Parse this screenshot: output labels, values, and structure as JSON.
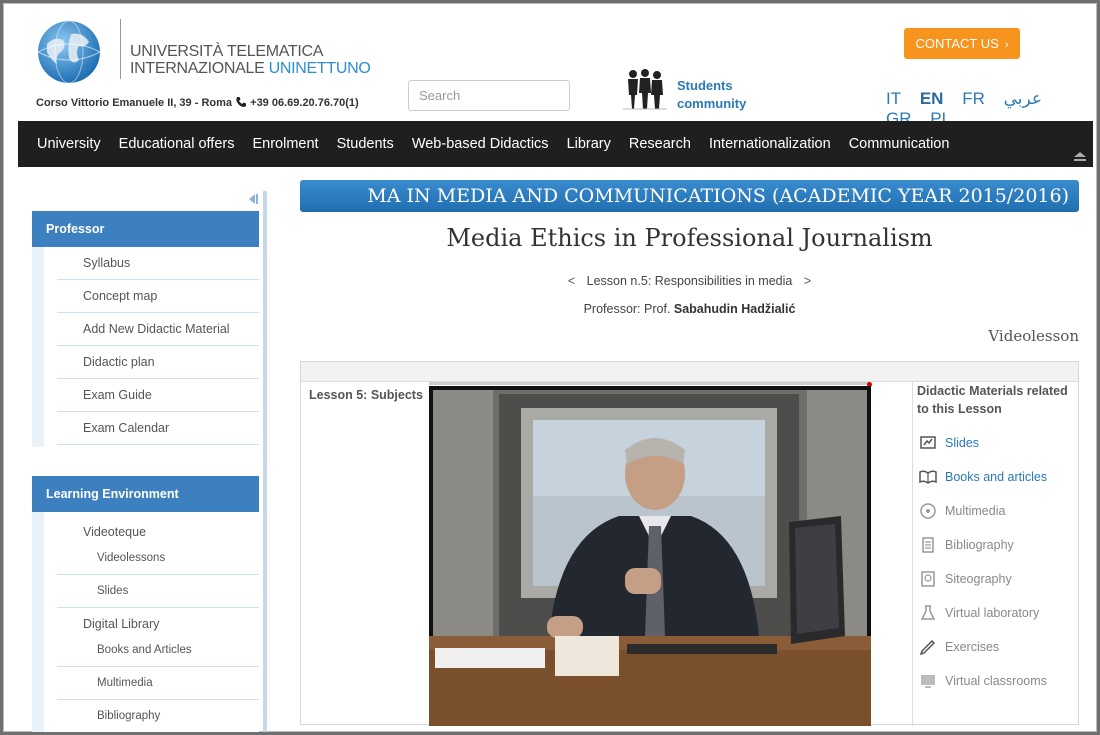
{
  "header": {
    "university_line1": "UNIVERSITÀ TELEMATICA",
    "university_line2a": "INTERNAZIONALE ",
    "university_line2b": "UNINETTUNO",
    "address": "Corso Vittorio Emanuele II, 39 - Roma",
    "phone": "+39 06.69.20.76.70(1)",
    "search_placeholder": "Search",
    "students_line1": "Students",
    "students_line2": "community",
    "contact_label": "CONTACT US",
    "languages": [
      "IT",
      "EN",
      "FR",
      "عربي",
      "GR",
      "PL"
    ],
    "active_language": "EN"
  },
  "nav": [
    "University",
    "Educational offers",
    "Enrolment",
    "Students",
    "Web-based Didactics",
    "Library",
    "Research",
    "Internationalization",
    "Communication"
  ],
  "sidebar": {
    "professor_title": "Professor",
    "professor_items": [
      "Syllabus",
      "Concept map",
      "Add New Didactic Material",
      "Didactic plan",
      "Exam Guide",
      "Exam Calendar"
    ],
    "learning_title": "Learning Environment",
    "groups": [
      {
        "label": "Videoteque",
        "items": [
          "Videolessons",
          "Slides"
        ]
      },
      {
        "label": "Digital Library",
        "items": [
          "Books and Articles",
          "Multimedia",
          "Bibliography"
        ]
      }
    ]
  },
  "main": {
    "course_banner": "MA IN MEDIA AND COMMUNICATIONS (ACADEMIC YEAR 2015/2016)",
    "course_title": "Media Ethics in Professional Journalism",
    "lesson_prev": "<",
    "lesson_label": "Lesson n.5: Responsibilities in media",
    "lesson_next": ">",
    "professor_prefix": "Professor: Prof. ",
    "professor_name": "Sabahudin Hadžialić",
    "section_label": "Videolesson",
    "subjects_label": "Lesson 5: Subjects",
    "materials_title": "Didactic Materials related to this Lesson",
    "materials": [
      {
        "label": "Slides",
        "icon": "slides-icon",
        "active": true
      },
      {
        "label": "Books and articles",
        "icon": "book-icon",
        "active": true
      },
      {
        "label": "Multimedia",
        "icon": "multimedia-icon",
        "active": false
      },
      {
        "label": "Bibliography",
        "icon": "bibliography-icon",
        "active": false
      },
      {
        "label": "Siteography",
        "icon": "siteography-icon",
        "active": false
      },
      {
        "label": "Virtual laboratory",
        "icon": "lab-icon",
        "active": false
      },
      {
        "label": "Exercises",
        "icon": "exercises-icon",
        "active": false
      },
      {
        "label": "Virtual classrooms",
        "icon": "classroom-icon",
        "active": false
      }
    ]
  },
  "colors": {
    "accent_blue": "#3d80c0",
    "nav_bg": "#1f1f1f",
    "contact_orange": "#f7941d",
    "link_blue": "#2a7ab7"
  }
}
